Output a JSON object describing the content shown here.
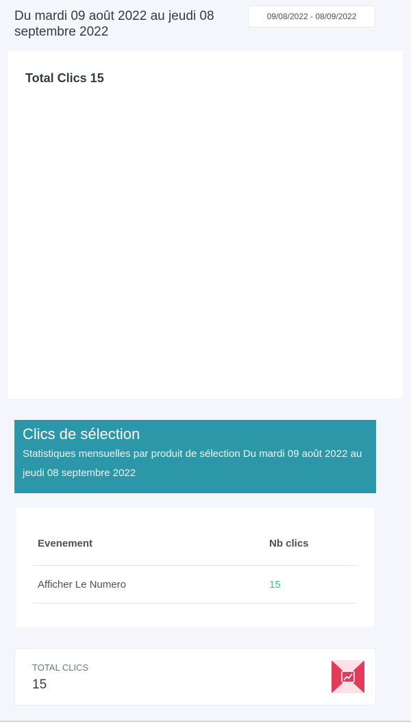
{
  "header": {
    "range_text": "Du mardi 09 août 2022 au jeudi 08 septembre 2022",
    "date_picker_value": "09/08/2022 - 08/09/2022"
  },
  "chart_card": {
    "title": "Total Clics 15"
  },
  "selection_section": {
    "title": "Clics de sélection",
    "subtitle": "Statistiques mensuelles par produit de sélection Du mardi 09 août 2022 au jeudi 08 septembre 2022"
  },
  "table": {
    "headers": [
      "Evenement",
      "Nb clics"
    ],
    "rows": [
      {
        "event": "Afficher Le Numero",
        "clicks": "15"
      }
    ]
  },
  "stat_card": {
    "label": "TOTAL CLICS",
    "value": "15",
    "icon": "trend-chart-icon",
    "icon_color": "#e63a5b"
  },
  "colors": {
    "accent": "#2c97a8",
    "positive": "#3ac47d",
    "page_bg": "#f5f6fb"
  }
}
